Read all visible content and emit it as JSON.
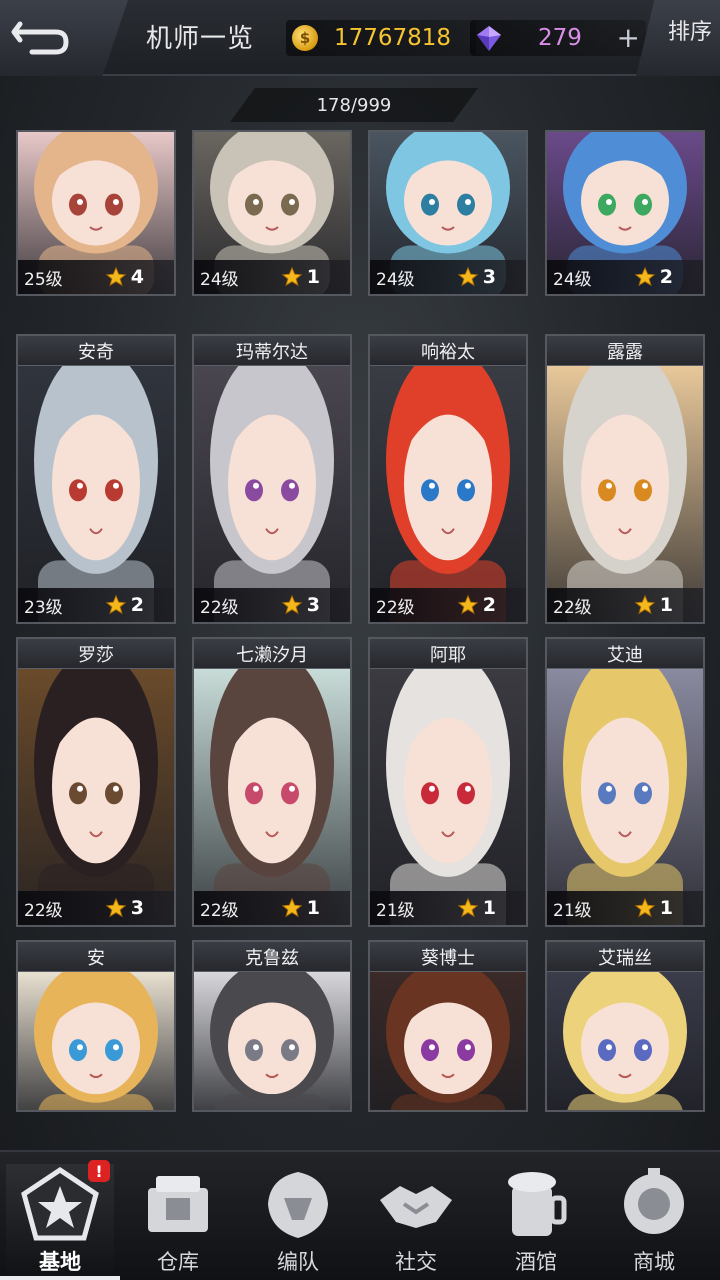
{
  "header": {
    "title": "机师一览",
    "gold": "17767818",
    "gems": "279",
    "plus": "+",
    "sort_label": "排序"
  },
  "count": "178/999",
  "cards": [
    {
      "name": "",
      "level": "25级",
      "stars": "4",
      "hair": "#e4b48a",
      "eyes": "#a8433a",
      "bg": "#e8c8c8"
    },
    {
      "name": "",
      "level": "24级",
      "stars": "1",
      "hair": "#c9c2b6",
      "eyes": "#7a6a50",
      "bg": "#6a6660"
    },
    {
      "name": "",
      "level": "24级",
      "stars": "3",
      "hair": "#7ec6e2",
      "eyes": "#2d7ea0",
      "bg": "#4a5560"
    },
    {
      "name": "",
      "level": "24级",
      "stars": "2",
      "hair": "#4f8ed6",
      "eyes": "#3ca860",
      "bg": "#6a4a8a"
    },
    {
      "name": "安奇",
      "level": "23级",
      "stars": "2",
      "hair": "#b8c2cc",
      "eyes": "#b83a30",
      "bg": "#30343c"
    },
    {
      "name": "玛蒂尔达",
      "level": "22级",
      "stars": "3",
      "hair": "#c6c6cc",
      "eyes": "#8a4aa0",
      "bg": "#4a4650"
    },
    {
      "name": "响裕太",
      "level": "22级",
      "stars": "2",
      "hair": "#e0402a",
      "eyes": "#2a78c8",
      "bg": "#3a3c44"
    },
    {
      "name": "露露",
      "level": "22级",
      "stars": "1",
      "hair": "#d6d2cc",
      "eyes": "#d88a20",
      "bg": "#e8c89a"
    },
    {
      "name": "罗莎",
      "level": "22级",
      "stars": "3",
      "hair": "#2a2022",
      "eyes": "#6a4a30",
      "bg": "#6a4a2a"
    },
    {
      "name": "七濑汐月",
      "level": "22级",
      "stars": "1",
      "hair": "#5a443e",
      "eyes": "#c84a6a",
      "bg": "#c8dcd8"
    },
    {
      "name": "阿耶",
      "level": "21级",
      "stars": "1",
      "hair": "#e6e2e0",
      "eyes": "#c82a3a",
      "bg": "#3a3a40"
    },
    {
      "name": "艾迪",
      "level": "21级",
      "stars": "1",
      "hair": "#e6c86a",
      "eyes": "#5a7ac0",
      "bg": "#8a8aa0"
    },
    {
      "name": "安",
      "level": "",
      "stars": "",
      "hair": "#e8b45a",
      "eyes": "#3a9ad8",
      "bg": "#e8e0d0"
    },
    {
      "name": "克鲁兹",
      "level": "",
      "stars": "",
      "hair": "#4a4a4e",
      "eyes": "#7a7a86",
      "bg": "#d8d8dc"
    },
    {
      "name": "葵博士",
      "level": "",
      "stars": "",
      "hair": "#6a3422",
      "eyes": "#8a3aa0",
      "bg": "#3a2a28"
    },
    {
      "name": "艾瑞丝",
      "level": "",
      "stars": "",
      "hair": "#ecd27a",
      "eyes": "#5a6ac0",
      "bg": "#3a3c4a"
    }
  ],
  "nav": [
    {
      "label": "基地",
      "icon": "base-icon",
      "active": true,
      "badge": "!"
    },
    {
      "label": "仓库",
      "icon": "warehouse-icon"
    },
    {
      "label": "编队",
      "icon": "formation-icon"
    },
    {
      "label": "社交",
      "icon": "handshake-icon"
    },
    {
      "label": "酒馆",
      "icon": "tavern-icon"
    },
    {
      "label": "商城",
      "icon": "shop-icon"
    }
  ]
}
